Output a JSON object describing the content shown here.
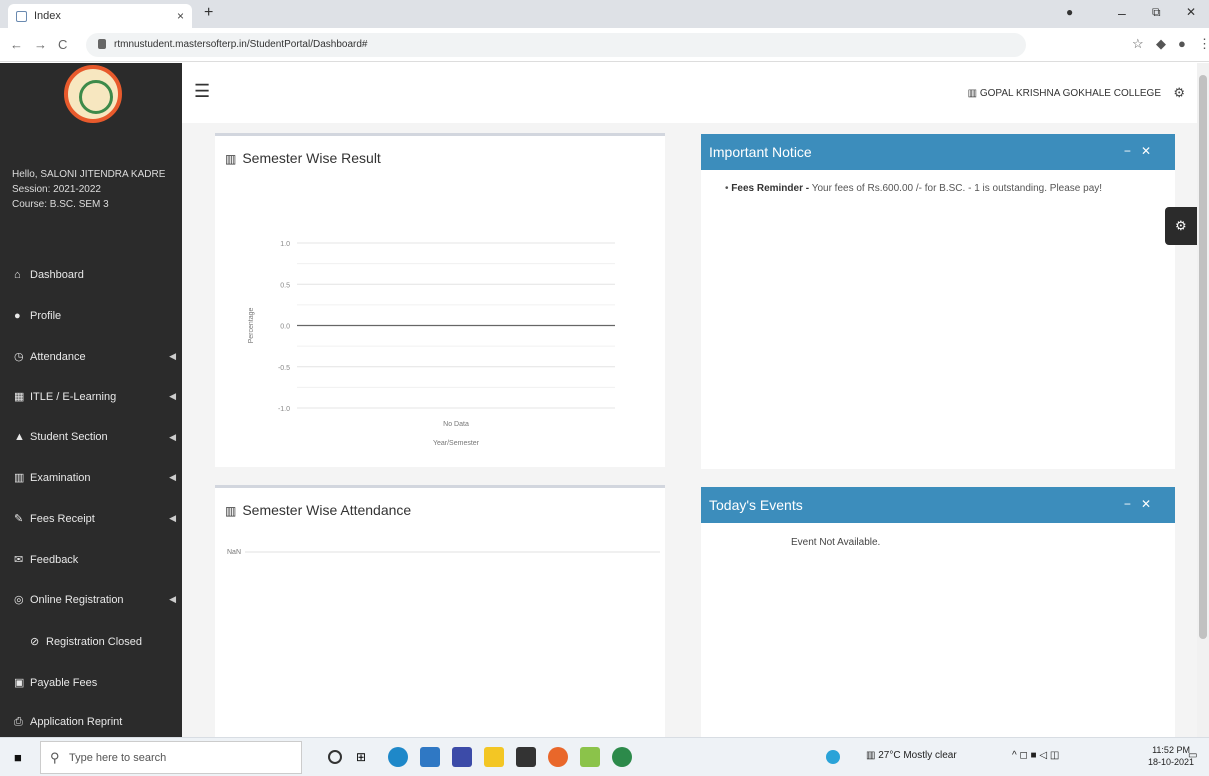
{
  "browser": {
    "tab_title": "Index",
    "tab_close": "×",
    "new_tab": "+",
    "minimize": "–",
    "restore": "⧉",
    "close": "✕",
    "url": "rtmnustudent.mastersofterp.in/StudentPortal/Dashboard#",
    "back": "←",
    "forward": "→",
    "reload": "C"
  },
  "sidebar": {
    "greeting": "Hello, SALONI JITENDRA KADRE",
    "session": "Session: 2021-2022",
    "course": "Course: B.SC. SEM 3",
    "items": [
      {
        "icon": "home-icon",
        "glyph": "⌂",
        "label": "Dashboard",
        "caret": false
      },
      {
        "icon": "user-icon",
        "glyph": "●",
        "label": "Profile",
        "caret": false
      },
      {
        "icon": "clock-icon",
        "glyph": "◷",
        "label": "Attendance",
        "caret": true
      },
      {
        "icon": "table-icon",
        "glyph": "▦",
        "label": "ITLE / E-Learning",
        "caret": true
      },
      {
        "icon": "student-icon",
        "glyph": "▲",
        "label": "Student Section",
        "caret": true
      },
      {
        "icon": "bank-icon",
        "glyph": "▥",
        "label": "Examination",
        "caret": true
      },
      {
        "icon": "fees-icon",
        "glyph": "✎",
        "label": "Fees Receipt",
        "caret": true
      },
      {
        "icon": "feedback-icon",
        "glyph": "✉",
        "label": "Feedback",
        "caret": false
      },
      {
        "icon": "globe-icon",
        "glyph": "◎",
        "label": "Online Registration",
        "caret": true
      },
      {
        "icon": "ban-icon",
        "glyph": "⊘",
        "label": "Registration Closed",
        "caret": false
      },
      {
        "icon": "payment-icon",
        "glyph": "▣",
        "label": "Payable Fees",
        "caret": false
      },
      {
        "icon": "print-icon",
        "glyph": "⎙",
        "label": "Application Reprint",
        "caret": false
      }
    ]
  },
  "header": {
    "college": "GOPAL KRISHNA GOKHALE COLLEGE"
  },
  "result_box": {
    "title": "Semester Wise Result",
    "chart_data": {
      "type": "line",
      "categories": [
        "No Data"
      ],
      "series": [
        {
          "values": [
            0
          ]
        }
      ],
      "ylim": [
        -1.0,
        1.0
      ],
      "yticks": [
        "1.0",
        "0.5",
        "0.0",
        "-0.5",
        "-1.0"
      ],
      "xlabel": "Year/Semester",
      "ylabel": "Percentage",
      "grid": true
    }
  },
  "attendance_box": {
    "title": "Semester Wise Attendance",
    "chart_data": {
      "type": "bar",
      "categories": [],
      "values": [],
      "ytick": "NaN"
    }
  },
  "notice_box": {
    "title": "Important Notice",
    "notice_label": "Fees Reminder -",
    "notice_text": "Your fees of Rs.600.00 /- for B.SC. - 1 is outstanding. Please pay!"
  },
  "events_box": {
    "title": "Today's Events",
    "message": "Event Not Available."
  },
  "taskbar": {
    "search_placeholder": "Type here to search",
    "weather": "27°C Mostly clear",
    "time": "11:52 PM",
    "date": "18-10-2021"
  },
  "colors": {
    "sidebar_bg": "#2b2b2b",
    "accent_blue": "#3c8dbc",
    "content_bg": "#f4f4f4"
  }
}
